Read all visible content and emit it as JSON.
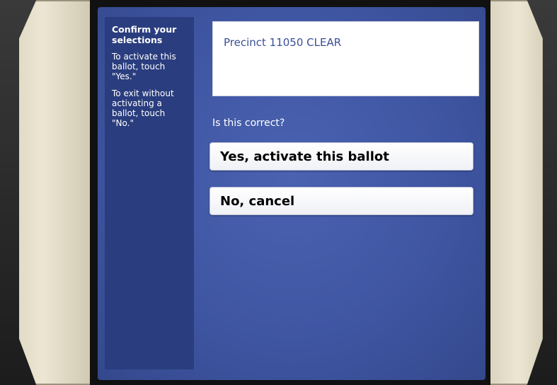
{
  "sidebar": {
    "title": "Confirm your selections",
    "instruction_yes": "To activate this ballot, touch \"Yes.\"",
    "instruction_no": "To exit without activating a ballot, touch \"No.\""
  },
  "precinct": {
    "label": "Precinct 11050 CLEAR"
  },
  "prompt": {
    "question": "Is this correct?"
  },
  "buttons": {
    "yes_label": "Yes, activate this ballot",
    "no_label": "No, cancel"
  },
  "colors": {
    "screen_bg": "#3f56a3",
    "sidebar_bg": "#2a3d7e",
    "precinct_text": "#3b4f98",
    "bezel": "#ece6d3"
  }
}
